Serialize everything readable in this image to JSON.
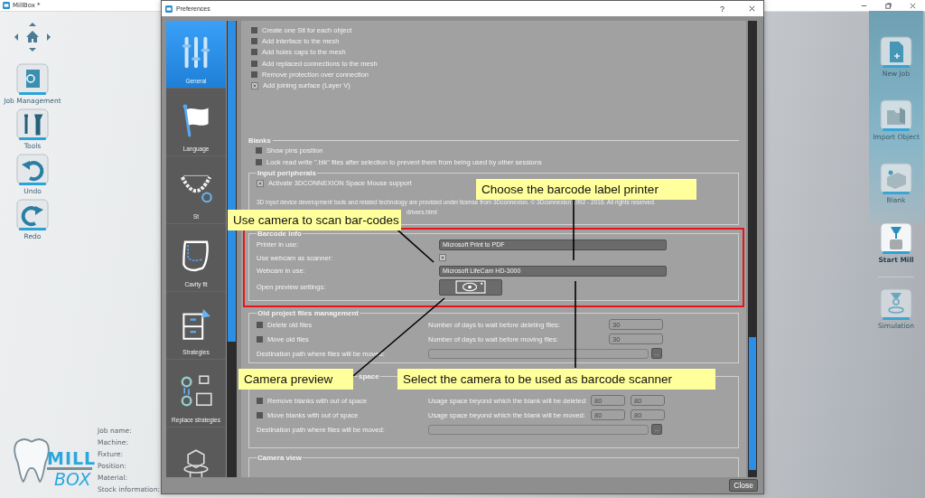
{
  "app": {
    "title": "MillBox *"
  },
  "left_toolbar": [
    {
      "label": "Job Management",
      "kind": "job"
    },
    {
      "label": "Tools",
      "kind": "tools"
    },
    {
      "label": "Undo",
      "kind": "undo"
    },
    {
      "label": "Redo",
      "kind": "redo"
    }
  ],
  "right_toolbar": {
    "panel": [
      {
        "label": "New Job",
        "kind": "new-job",
        "disabled": true
      },
      {
        "label": "Import Object",
        "kind": "import",
        "disabled": true
      },
      {
        "label": "Blank",
        "kind": "blank",
        "disabled": true
      }
    ],
    "items": [
      {
        "label": "Start Mill",
        "kind": "mill",
        "disabled": false
      },
      {
        "label": "Simulation",
        "kind": "simulation",
        "disabled": true
      }
    ]
  },
  "logo": {
    "line1": "MILL",
    "line2": "BOX"
  },
  "job_info": [
    "Job name:",
    "Machine:",
    "Fixture:",
    "Position:",
    "Material:",
    "Stock information:"
  ],
  "dialog": {
    "title": "Preferences",
    "help": "?",
    "nav": [
      {
        "label": "General",
        "kind": "general",
        "selected": true
      },
      {
        "label": "Language",
        "kind": "language",
        "selected": false
      },
      {
        "label": "St",
        "kind": "stl",
        "selected": false
      },
      {
        "label": "Cavity fit",
        "kind": "cavity",
        "selected": false
      },
      {
        "label": "Strategies",
        "kind": "strategies",
        "selected": false
      },
      {
        "label": "Replace strategies",
        "kind": "replace",
        "selected": false
      },
      {
        "kind": "fixture",
        "selected": false
      }
    ],
    "general_options": [
      {
        "label": "Create one Stl for each object",
        "checked": false
      },
      {
        "label": "Add interface to the mesh",
        "checked": false
      },
      {
        "label": "Add holes caps to the mesh",
        "checked": false
      },
      {
        "label": "Add replaced connections to the mesh",
        "checked": false
      },
      {
        "label": "Remove protection over connection",
        "checked": false
      },
      {
        "label": "Add joining surface (Layer V)",
        "checked": true
      }
    ],
    "blanks": {
      "title": "Blanks",
      "options": [
        {
          "label": "Show pins position",
          "checked": false
        },
        {
          "label": "Lock read write \".blk\" files after selection to prevent them from being used by other sessions",
          "checked": false
        }
      ]
    },
    "input_peripherals": {
      "title": "Input peripherals",
      "options": [
        {
          "label": "Activate 3DCONNEXION Space Mouse support",
          "checked": true
        }
      ],
      "notice": "3D input device development tools and related technology are provided under license from 3Dconnexion. © 3Dconnexion 1992 - 2016. All rights reserved.",
      "link": "drivers.html"
    },
    "barcode": {
      "title": "Barcode Info",
      "printer_label": "Printer in use:",
      "printer": "Microsoft Print to PDF",
      "scanner_label": "Use webcam as scanner:",
      "scanner_checked": true,
      "webcam_label": "Webcam in use:",
      "webcam": "Microsoft LifeCam HD-3000",
      "preview_label": "Open preview settings:"
    },
    "old_files": {
      "title": "Old project files management",
      "rows": [
        {
          "label": "Delete old files",
          "checked": false,
          "setting": "Number of days to wait before deleting files:",
          "value": "30"
        },
        {
          "label": "Move old files",
          "checked": false,
          "setting": "Number of days to wait before moving files:",
          "value": "30"
        }
      ],
      "path_label": "Destination path where files will be moved:",
      "browse": "..."
    },
    "blank_space": {
      "title": "space",
      "rows": [
        {
          "label": "Remove blanks with out of space",
          "checked": false,
          "setting": "Usage space beyond which the blank will be deleted:",
          "values": [
            "80",
            "80"
          ]
        },
        {
          "label": "Move blanks with out of space",
          "checked": false,
          "setting": "Usage space beyond which the blank will be moved:",
          "values": [
            "80",
            "80"
          ]
        }
      ],
      "path_label": "Destination path where files will be moved:",
      "browse": "..."
    },
    "camera_view": {
      "title": "Camera view"
    },
    "close_button": "Close"
  },
  "callouts": [
    {
      "text": "Choose the barcode label printer"
    },
    {
      "text": "Use camera to scan bar-codes"
    },
    {
      "text": "Camera preview"
    },
    {
      "text": "Select the camera to be used as barcode scanner"
    }
  ]
}
